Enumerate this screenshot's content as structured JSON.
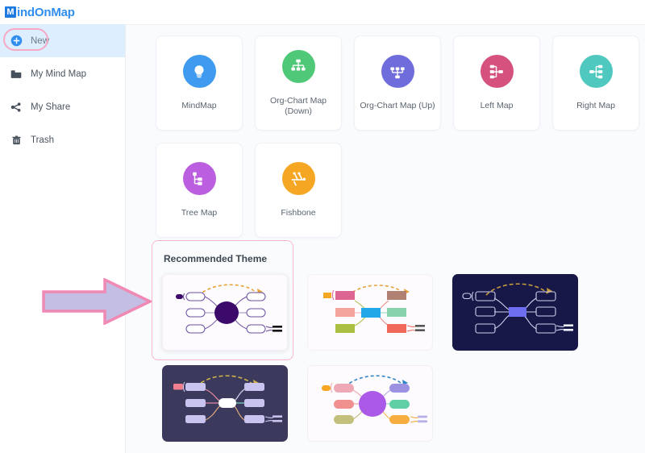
{
  "app": {
    "logo_mark": "M",
    "logo_text": "indOnMap",
    "brand_color": "#2f8ef0"
  },
  "sidebar": {
    "items": [
      {
        "label": "New",
        "icon": "plus-circle-icon",
        "active": true
      },
      {
        "label": "My Mind Map",
        "icon": "folder-icon",
        "active": false
      },
      {
        "label": "My Share",
        "icon": "share-icon",
        "active": false
      },
      {
        "label": "Trash",
        "icon": "trash-icon",
        "active": false
      }
    ]
  },
  "templates": [
    {
      "label": "MindMap",
      "icon": "lightbulb-icon",
      "color": "#3e9bf0"
    },
    {
      "label": "Org-Chart Map (Down)",
      "icon": "org-chart-down-icon",
      "color": "#4fc878"
    },
    {
      "label": "Org-Chart Map (Up)",
      "icon": "org-chart-up-icon",
      "color": "#6f6ddb"
    },
    {
      "label": "Left Map",
      "icon": "left-map-icon",
      "color": "#d5527e"
    },
    {
      "label": "Right Map",
      "icon": "right-map-icon",
      "color": "#4fc8c0"
    },
    {
      "label": "Tree Map",
      "icon": "tree-map-icon",
      "color": "#bb5fe0"
    },
    {
      "label": "Fishbone",
      "icon": "fishbone-icon",
      "color": "#f5a623"
    }
  ],
  "themes": {
    "title": "Recommended Theme",
    "highlight_color": "#f7b6cd",
    "cards": [
      {
        "name": "theme-violet-light",
        "style": "light",
        "selected": true,
        "bg": "#fdfbfd",
        "center": "#3b0a6b",
        "node_border": "#6b4f9e",
        "node_fill": "#ffffff",
        "arc": "#e8a33d",
        "center_shape": "circle"
      },
      {
        "name": "theme-colorful-light",
        "style": "light2",
        "selected": false,
        "bg": "#fdfbfd",
        "center": "#22a7e8",
        "node_border": "none",
        "node_fill": "multi",
        "arc": "#e8a33d",
        "center_shape": "rect"
      },
      {
        "name": "theme-navy-dark",
        "style": "dark-navy",
        "selected": false,
        "bg": "#171847",
        "center": "#6e6ef0",
        "node_border": "#c9cbe8",
        "node_fill": "#171847",
        "arc": "#c79a3c",
        "center_shape": "rect"
      },
      {
        "name": "theme-slate-dark",
        "style": "dark-slate",
        "selected": false,
        "bg": "#3b3a5c",
        "center": "#ffffff",
        "node_border": "none",
        "node_fill": "#c8c4ef",
        "arc": "#d2b14a",
        "center_shape": "rect"
      },
      {
        "name": "theme-purple-light",
        "style": "light",
        "selected": false,
        "bg": "#fdfbfd",
        "center": "#ab5ae8",
        "node_border": "none",
        "node_fill": "multi",
        "arc": "#2f86c9",
        "center_shape": "circle"
      }
    ]
  },
  "annotation": {
    "arrow": {
      "name": "pointer-arrow",
      "fill": "#c4bde4",
      "stroke": "#f08ab4"
    }
  }
}
